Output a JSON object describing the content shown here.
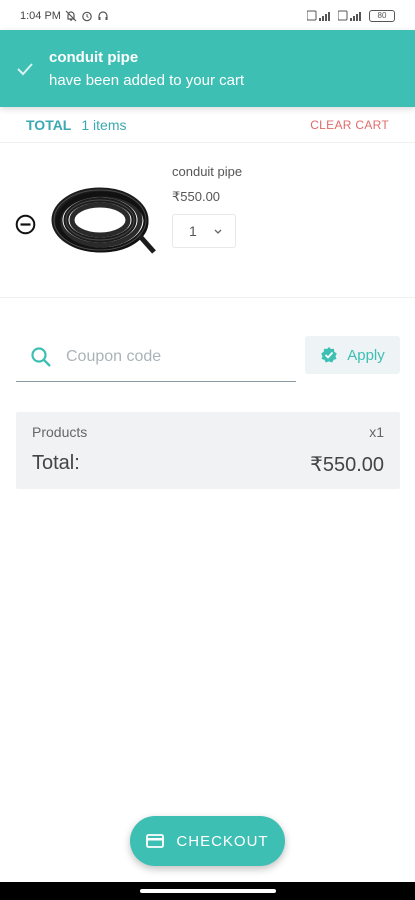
{
  "status_bar": {
    "time": "1:04 PM",
    "battery": "80"
  },
  "snackbar": {
    "title": "conduit pipe",
    "message": "have been added to your cart",
    "icon": "check-icon"
  },
  "cart_header": {
    "total_label": "TOTAL",
    "items_count": "1 items",
    "clear_label": "CLEAR CART"
  },
  "cart_items": [
    {
      "name": "conduit pipe",
      "price": "₹550.00",
      "quantity": "1"
    }
  ],
  "coupon": {
    "placeholder": "Coupon code",
    "apply_label": "Apply"
  },
  "summary": {
    "products_label": "Products",
    "products_count": "x1",
    "total_label": "Total:",
    "total_value": "₹550.00"
  },
  "checkout": {
    "label": "CHECKOUT"
  },
  "colors": {
    "accent": "#3dbfb3",
    "header_text": "#3aa9b1",
    "danger": "#e06b6b",
    "summary_bg": "#f0f2f4"
  }
}
